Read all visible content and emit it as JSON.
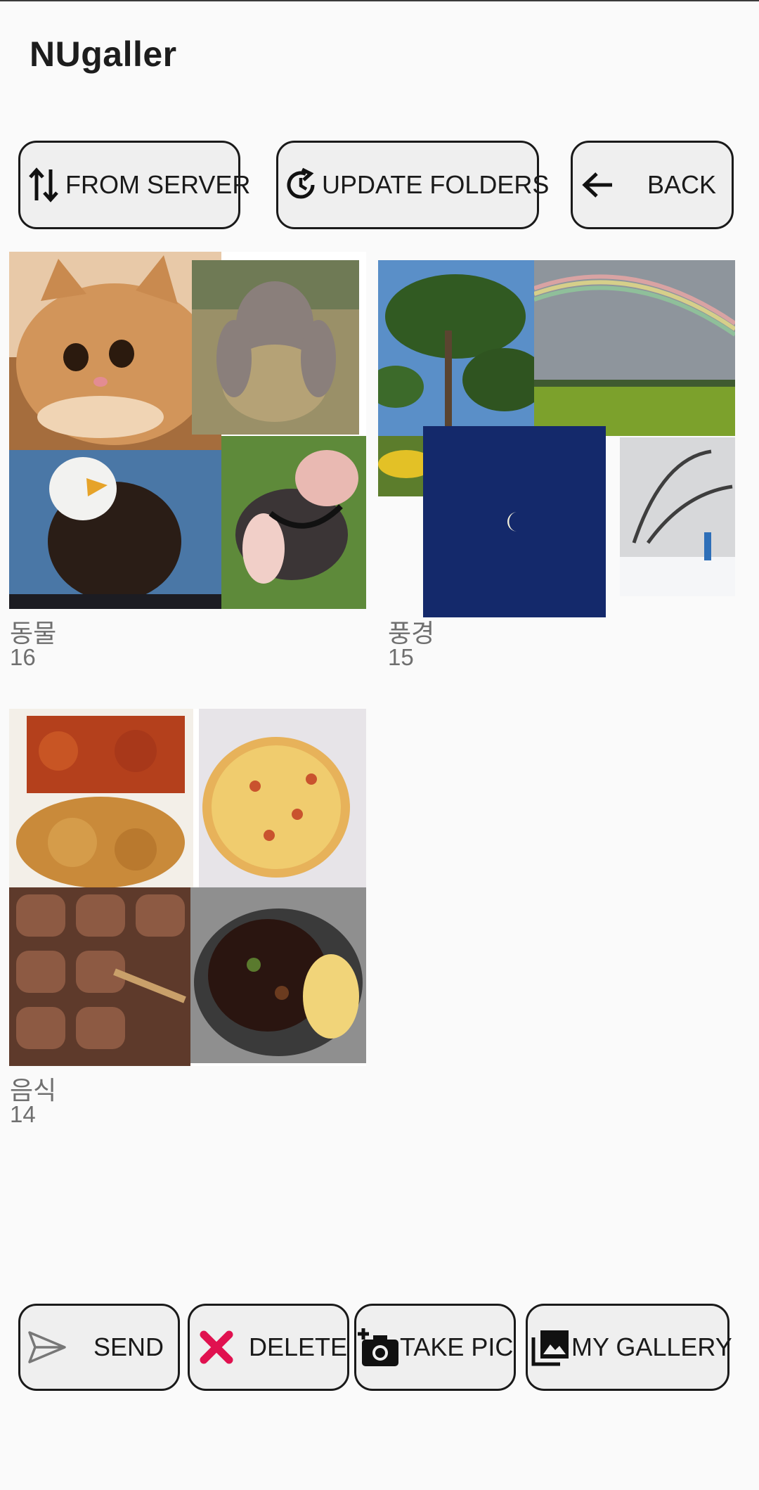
{
  "app": {
    "title": "NUgaller"
  },
  "top_buttons": {
    "from_server": "FROM SERVER",
    "update_folders": "UPDATE FOLDERS",
    "back": "BACK"
  },
  "folders": [
    {
      "name": "동물",
      "count": "16"
    },
    {
      "name": "풍경",
      "count": "15"
    },
    {
      "name": "음식",
      "count": "14"
    }
  ],
  "bottom_buttons": {
    "send": "SEND",
    "delete": "DELETE",
    "take_pic": "TAKE PIC",
    "my_gallery": "MY GALLERY"
  },
  "colors": {
    "background": "#fafafa",
    "button_fill": "#efefef",
    "button_border": "#1a1a1a",
    "delete_icon": "#e0114f",
    "caption_text": "#6f6f6f"
  },
  "icons": {
    "from_server": "swap-vertical-icon",
    "update_folders": "refresh-clock-icon",
    "back": "arrow-left-icon",
    "send": "send-icon",
    "delete": "close-x-icon",
    "take_pic": "add-camera-icon",
    "my_gallery": "photo-library-icon"
  }
}
